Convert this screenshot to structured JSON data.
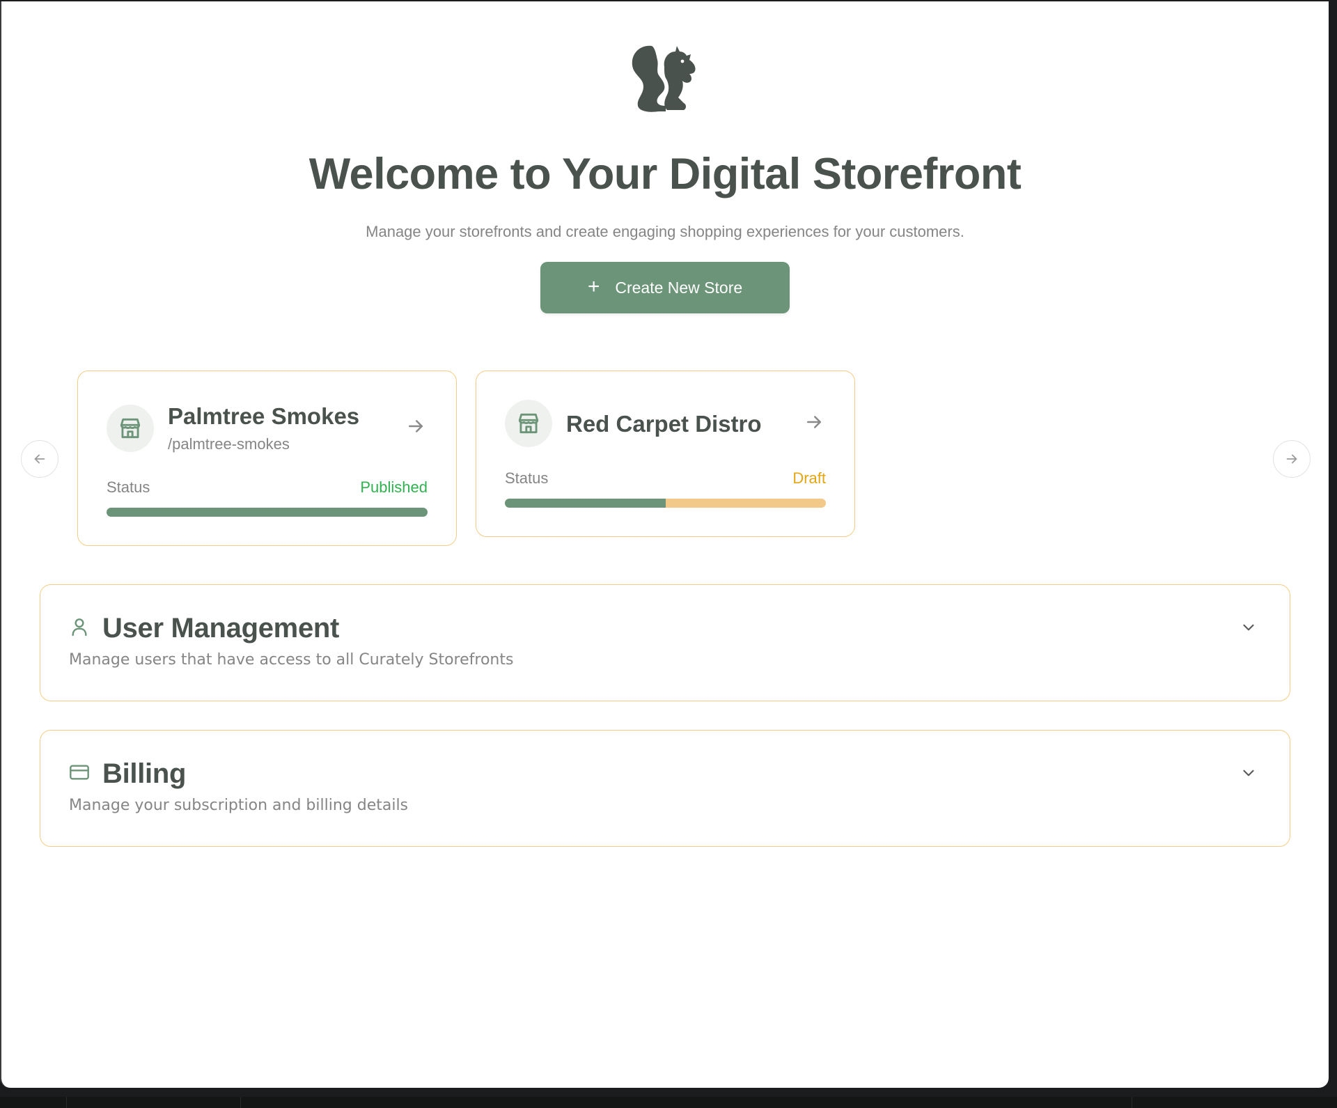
{
  "page": {
    "title": "Welcome to Your Digital Storefront",
    "subtitle": "Manage your storefronts and create engaging shopping experiences for your customers."
  },
  "actions": {
    "create_store_label": "Create New Store",
    "create_store_icon": "plus-icon"
  },
  "carousel": {
    "prev_icon": "arrow-left-icon",
    "next_icon": "arrow-right-icon"
  },
  "stores": [
    {
      "name": "Palmtree Smokes",
      "slug": "/palmtree-smokes",
      "status_label": "Status",
      "status": "Published",
      "status_color": "#2fb350",
      "progress": 1.0
    },
    {
      "name": "Red Carpet Distro",
      "slug": "",
      "status_label": "Status",
      "status": "Draft",
      "status_color": "#e3a512",
      "progress": 0.5
    }
  ],
  "sections": {
    "users": {
      "title": "User Management",
      "description": "Manage users that have access to all Curately Storefronts",
      "icon": "user-icon"
    },
    "billing": {
      "title": "Billing",
      "description": "Manage your subscription and billing details",
      "icon": "credit-card-icon"
    }
  },
  "colors": {
    "accent": "#6c9478",
    "border": "#f3cd86",
    "heading": "#4a524d",
    "muted": "#858585",
    "draft_track": "#f3c98a"
  }
}
